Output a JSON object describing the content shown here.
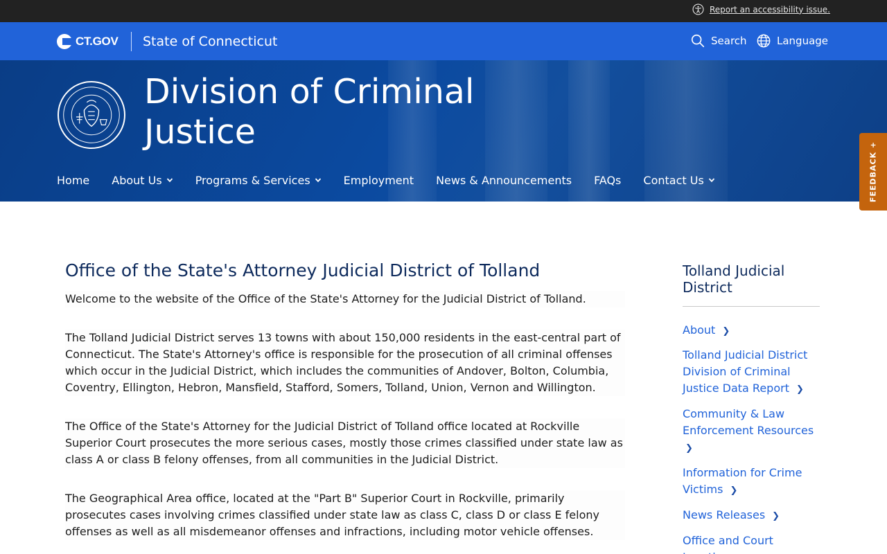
{
  "utility": {
    "accessibility_link": "Report an accessibility issue."
  },
  "ct_header": {
    "logo_text": "CT.GOV",
    "state_name": "State of Connecticut",
    "search_label": "Search",
    "language_label": "Language"
  },
  "banner": {
    "agency_title": "Division of Criminal Justice",
    "seal_text_top": "STATE OF CONNECTICUT",
    "seal_text_bottom": "DIVISION OF CRIMINAL JUSTICE"
  },
  "nav": {
    "items": [
      {
        "label": "Home",
        "has_dropdown": false
      },
      {
        "label": "About Us",
        "has_dropdown": true
      },
      {
        "label": "Programs & Services",
        "has_dropdown": true
      },
      {
        "label": "Employment",
        "has_dropdown": false
      },
      {
        "label": "News & Announcements",
        "has_dropdown": false
      },
      {
        "label": "FAQs",
        "has_dropdown": false
      },
      {
        "label": "Contact Us",
        "has_dropdown": true
      }
    ]
  },
  "feedback": {
    "label": "FEEDBACK +"
  },
  "main": {
    "title": "Office of the State's Attorney Judicial District of Tolland",
    "paragraphs": [
      "Welcome to the website of the Office of the State's Attorney for the Judicial District of Tolland.",
      "The Tolland Judicial District serves 13 towns with about 150,000 residents in the east-central part of Connecticut. The State's Attorney's office is responsible for the prosecution of all criminal offenses which occur in the Judicial District, which includes the communities of Andover, Bolton, Columbia, Coventry, Ellington, Hebron, Mansfield, Stafford, Somers, Tolland, Union, Vernon and Willington.",
      "The Office of the State's Attorney for the Judicial District of Tolland office located at Rockville Superior Court prosecutes the more serious cases, mostly those crimes classified under state law as class A or class B felony offenses, from all communities in the Judicial District.",
      "The Geographical Area office, located at the \"Part B\" Superior Court in Rockville, primarily prosecutes cases involving crimes classified under state law as class C, class D or class E felony offenses as well as all misdemeanor offenses and infractions, including motor vehicle offenses."
    ]
  },
  "sidebar": {
    "title": "Tolland Judicial District",
    "links": [
      "About",
      "Tolland Judicial District Division of Criminal Justice Data Report",
      "Community & Law Enforcement Resources",
      "Information for Crime Victims",
      "News Releases",
      "Office and Court Locations"
    ]
  },
  "colors": {
    "utility_bar": "#222222",
    "ct_blue": "#2163d9",
    "banner_navy": "#0b4aa0",
    "title_navy": "#0d2a5c",
    "feedback_orange": "#c4640d"
  }
}
